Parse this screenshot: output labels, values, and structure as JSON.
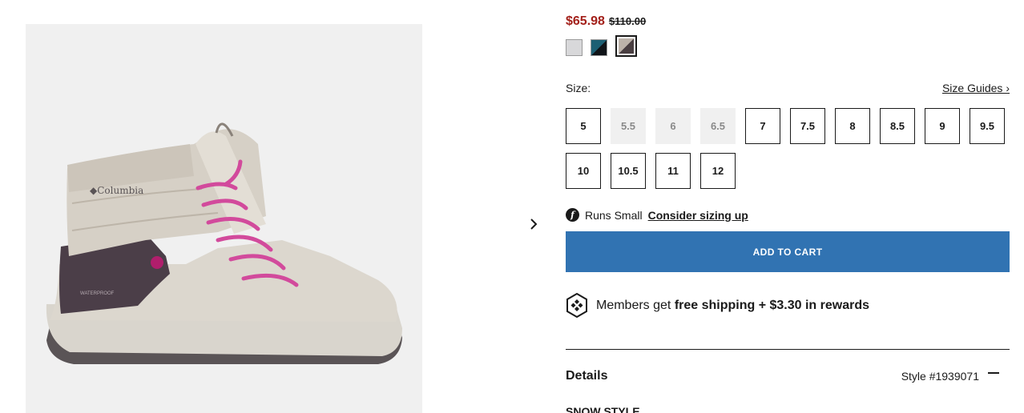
{
  "product": {
    "image_alt": "Women's Slopeside Village Omni-Heat Hi boot",
    "price": {
      "sale": "$65.98",
      "original": "$110.00",
      "sale_color": "#a3201a"
    },
    "swatches": [
      {
        "name": "light-grey",
        "colors": [
          "#d8d8da",
          "#d8d8da"
        ],
        "selected": false
      },
      {
        "name": "teal-black",
        "colors": [
          "#1d5f73",
          "#101418"
        ],
        "selected": false
      },
      {
        "name": "taupe-dark",
        "colors": [
          "#bdb3aa",
          "#4a3f42"
        ],
        "selected": true
      }
    ],
    "size": {
      "label": "Size:",
      "guides_link": "Size Guides ›",
      "options": [
        {
          "value": "5",
          "available": true
        },
        {
          "value": "5.5",
          "available": false
        },
        {
          "value": "6",
          "available": false
        },
        {
          "value": "6.5",
          "available": false
        },
        {
          "value": "7",
          "available": true
        },
        {
          "value": "7.5",
          "available": true
        },
        {
          "value": "8",
          "available": true
        },
        {
          "value": "8.5",
          "available": true
        },
        {
          "value": "9",
          "available": true
        },
        {
          "value": "9.5",
          "available": true
        },
        {
          "value": "10",
          "available": true
        },
        {
          "value": "10.5",
          "available": true
        },
        {
          "value": "11",
          "available": true
        },
        {
          "value": "12",
          "available": true
        }
      ]
    },
    "fit": {
      "icon_glyph": "f",
      "text": "Runs Small",
      "link": "Consider sizing up"
    },
    "add_to_cart": {
      "label": "ADD TO CART",
      "color": "#3173b2"
    },
    "members": {
      "prefix": "Members get ",
      "bold": "free shipping + $3.30 in rewards"
    },
    "details": {
      "title": "Details",
      "style_number": "Style #1939071",
      "subheading": "SNOW STYLE"
    }
  }
}
